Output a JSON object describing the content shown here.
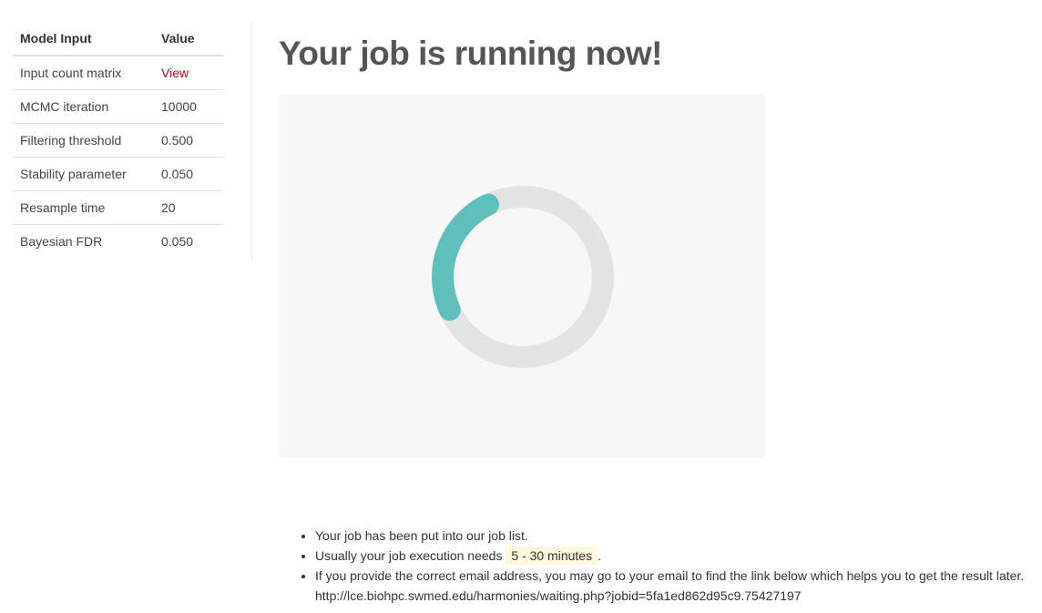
{
  "params_table": {
    "header": {
      "name": "Model Input",
      "value": "Value"
    },
    "rows": [
      {
        "name": "Input count matrix",
        "value": "View"
      },
      {
        "name": "MCMC iteration",
        "value": "10000"
      },
      {
        "name": "Filtering threshold",
        "value": "0.500"
      },
      {
        "name": "Stability parameter",
        "value": "0.050"
      },
      {
        "name": "Resample time",
        "value": "20"
      },
      {
        "name": "Bayesian FDR",
        "value": "0.050"
      }
    ]
  },
  "main": {
    "title": "Your job is running now!",
    "spinner": {
      "track_color": "#e2e4e4",
      "arc_color": "#5fbfbd",
      "background": "#f7f7f7",
      "icon": "loading-spinner-icon"
    },
    "info": {
      "line1": "Your job has been put into our job list.",
      "line2_prefix": "Usually your job execution needs",
      "line2_highlight": "5 - 30 minutes",
      "line2_suffix": ".",
      "line3": "If you provide the correct email address, you may go to your email to find the link below which helps you to get the result later.",
      "line3_url": "http://lce.biohpc.swmed.edu/harmonies/waiting.php?jobid=5fa1ed862d95c9.75427197"
    }
  },
  "colors": {
    "link_red": "#d0021b",
    "title_gray": "#555555",
    "highlight_bg": "#fdf7dc"
  }
}
